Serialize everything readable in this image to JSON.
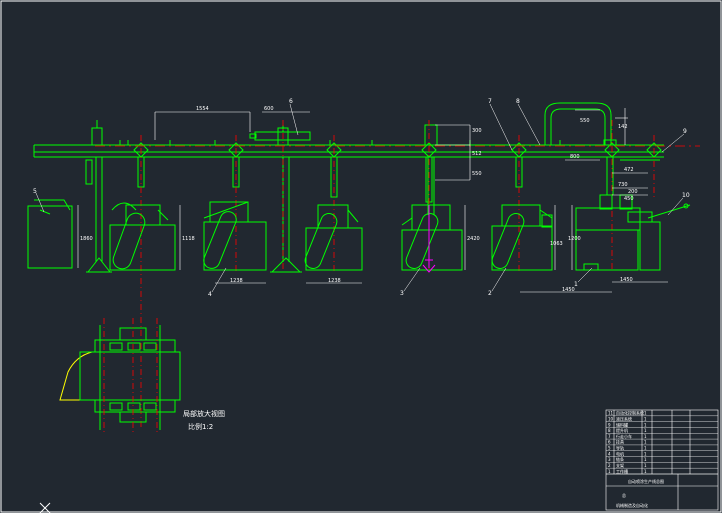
{
  "colors": {
    "background": "#212830",
    "structure": "#00ff00",
    "dimension": "#ffffff",
    "centerline": "#ff0000",
    "detail_outline": "#ffff00",
    "hook": "#ff00ff",
    "frame": "#ffffff"
  },
  "dimensions": {
    "top_span": "1554",
    "stroke": "600",
    "right_span": "800",
    "top_right_1": "550",
    "top_right_2": "142",
    "h1": "300",
    "h2": "512",
    "v1": "1860",
    "v2": "2420",
    "v3": "550",
    "v4": "1063",
    "v5": "1118",
    "v6": "1200",
    "d1": "730",
    "d2": "200",
    "d3": "472",
    "d4": "450",
    "w1": "1238",
    "w2": "1238",
    "w3": "1450",
    "w4": "1450"
  },
  "callouts": [
    "1",
    "2",
    "3",
    "4",
    "5",
    "6",
    "7",
    "8",
    "9",
    "10"
  ],
  "detail": {
    "caption_line1": "局部放大视图",
    "caption_line2": "比例1:2"
  },
  "title_block": {
    "parts_rows": [
      [
        "11",
        "自动化控制系统",
        "1"
      ],
      [
        "10",
        "液压系统",
        "1"
      ],
      [
        "9",
        "储料罐",
        "1"
      ],
      [
        "8",
        "提升机",
        "1"
      ],
      [
        "7",
        "行走小车",
        "1"
      ],
      [
        "6",
        "挂具",
        "1"
      ],
      [
        "5",
        "导轨",
        "1"
      ],
      [
        "4",
        "电机",
        "1"
      ],
      [
        "3",
        "链条",
        "1"
      ],
      [
        "2",
        "支架",
        "1"
      ],
      [
        "1",
        "工作槽",
        "1"
      ]
    ],
    "drawing_title": "自动喷涂生产线总图",
    "sheet_label": "总",
    "school": "机械制造及自动化"
  }
}
